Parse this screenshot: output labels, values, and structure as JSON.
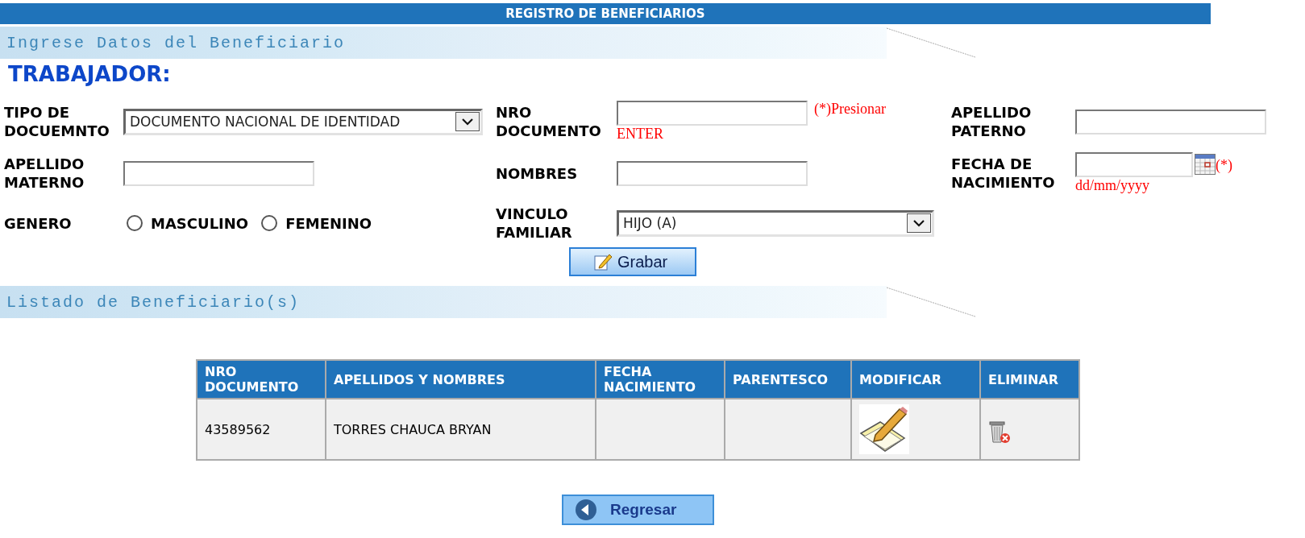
{
  "title_bar": {
    "title": "REGISTRO DE BENEFICIARIOS"
  },
  "entry_section": {
    "header": "Ingrese Datos del Beneficiario",
    "worker_label": "TRABAJADOR:",
    "fields": [
      {
        "kind": "select",
        "label": "TIPO DE DOCUEMNTO",
        "value": "DOCUMENTO NACIONAL DE IDENTIDAD"
      },
      {
        "kind": "text",
        "label": "NRO DOCUMENTO",
        "note_right": "(*)Presionar",
        "note_below": "ENTER"
      },
      {
        "kind": "text",
        "label": "APELLIDO PATERNO"
      },
      {
        "kind": "text",
        "label": "APELLIDO MATERNO"
      },
      {
        "kind": "text",
        "label": "NOMBRES"
      },
      {
        "kind": "date",
        "label": "FECHA DE NACIMIENTO",
        "note_right": "(*)",
        "note_below": "dd/mm/yyyy"
      },
      {
        "kind": "radio",
        "label": "GENERO",
        "options": [
          {
            "label": "MASCULINO",
            "selected": false
          },
          {
            "label": "FEMENINO",
            "selected": false
          }
        ]
      },
      {
        "kind": "select",
        "label": "VINCULO FAMILIAR",
        "value": "HIJO (A)"
      }
    ],
    "save_button": "Grabar"
  },
  "list_section": {
    "header": "Listado de Beneficiario(s)",
    "table": {
      "columns": [
        "NRO DOCUMENTO",
        "APELLIDOS Y NOMBRES",
        "FECHA NACIMIENTO",
        "PARENTESCO",
        "MODIFICAR",
        "ELIMINAR"
      ],
      "rows": [
        {
          "nro_documento": "43589562",
          "apellidos_y_nombres": "TORRES CHAUCA BRYAN"
        }
      ]
    }
  },
  "back_button": "Regresar"
}
